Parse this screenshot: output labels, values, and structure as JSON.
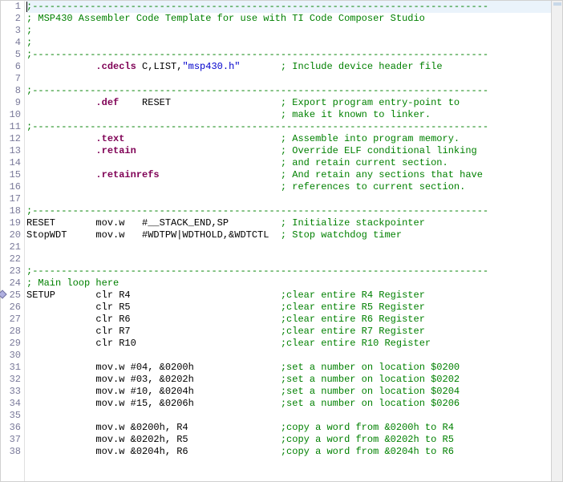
{
  "editor": {
    "cursor_line": 1,
    "marker_line": 25,
    "lines": [
      {
        "n": 1,
        "segments": [
          {
            "cls": "c-comment",
            "t": ";-------------------------------------------------------------------------------"
          }
        ]
      },
      {
        "n": 2,
        "segments": [
          {
            "cls": "c-comment",
            "t": "; MSP430 Assembler Code Template for use with TI Code Composer Studio"
          }
        ]
      },
      {
        "n": 3,
        "segments": [
          {
            "cls": "c-comment",
            "t": ";"
          }
        ]
      },
      {
        "n": 4,
        "segments": [
          {
            "cls": "c-comment",
            "t": ";"
          }
        ]
      },
      {
        "n": 5,
        "segments": [
          {
            "cls": "c-comment",
            "t": ";-------------------------------------------------------------------------------"
          }
        ]
      },
      {
        "n": 6,
        "segments": [
          {
            "cls": "c-plain",
            "t": "            "
          },
          {
            "cls": "c-directive",
            "t": ".cdecls"
          },
          {
            "cls": "c-plain",
            "t": " C,LIST,"
          },
          {
            "cls": "c-string",
            "t": "\"msp430.h\""
          },
          {
            "cls": "c-plain",
            "t": "       "
          },
          {
            "cls": "c-comment",
            "t": "; Include device header file"
          }
        ]
      },
      {
        "n": 7,
        "segments": [
          {
            "cls": "c-plain",
            "t": ""
          }
        ]
      },
      {
        "n": 8,
        "segments": [
          {
            "cls": "c-comment",
            "t": ";-------------------------------------------------------------------------------"
          }
        ]
      },
      {
        "n": 9,
        "segments": [
          {
            "cls": "c-plain",
            "t": "            "
          },
          {
            "cls": "c-directive",
            "t": ".def"
          },
          {
            "cls": "c-plain",
            "t": "    RESET                   "
          },
          {
            "cls": "c-comment",
            "t": "; Export program entry-point to"
          }
        ]
      },
      {
        "n": 10,
        "segments": [
          {
            "cls": "c-plain",
            "t": "                                            "
          },
          {
            "cls": "c-comment",
            "t": "; make it known to linker."
          }
        ]
      },
      {
        "n": 11,
        "segments": [
          {
            "cls": "c-comment",
            "t": ";-------------------------------------------------------------------------------"
          }
        ]
      },
      {
        "n": 12,
        "segments": [
          {
            "cls": "c-plain",
            "t": "            "
          },
          {
            "cls": "c-directive",
            "t": ".text"
          },
          {
            "cls": "c-plain",
            "t": "                           "
          },
          {
            "cls": "c-comment",
            "t": "; Assemble into program memory."
          }
        ]
      },
      {
        "n": 13,
        "segments": [
          {
            "cls": "c-plain",
            "t": "            "
          },
          {
            "cls": "c-directive",
            "t": ".retain"
          },
          {
            "cls": "c-plain",
            "t": "                         "
          },
          {
            "cls": "c-comment",
            "t": "; Override ELF conditional linking"
          }
        ]
      },
      {
        "n": 14,
        "segments": [
          {
            "cls": "c-plain",
            "t": "                                            "
          },
          {
            "cls": "c-comment",
            "t": "; and retain current section."
          }
        ]
      },
      {
        "n": 15,
        "segments": [
          {
            "cls": "c-plain",
            "t": "            "
          },
          {
            "cls": "c-directive",
            "t": ".retainrefs"
          },
          {
            "cls": "c-plain",
            "t": "                     "
          },
          {
            "cls": "c-comment",
            "t": "; And retain any sections that have"
          }
        ]
      },
      {
        "n": 16,
        "segments": [
          {
            "cls": "c-plain",
            "t": "                                            "
          },
          {
            "cls": "c-comment",
            "t": "; references to current section."
          }
        ]
      },
      {
        "n": 17,
        "segments": [
          {
            "cls": "c-plain",
            "t": ""
          }
        ]
      },
      {
        "n": 18,
        "segments": [
          {
            "cls": "c-comment",
            "t": ";-------------------------------------------------------------------------------"
          }
        ]
      },
      {
        "n": 19,
        "segments": [
          {
            "cls": "c-plain",
            "t": "RESET       mov.w   #__STACK_END,SP         "
          },
          {
            "cls": "c-comment",
            "t": "; Initialize stackpointer"
          }
        ]
      },
      {
        "n": 20,
        "segments": [
          {
            "cls": "c-plain",
            "t": "StopWDT     mov.w   #WDTPW|WDTHOLD,&WDTCTL  "
          },
          {
            "cls": "c-comment",
            "t": "; Stop watchdog timer"
          }
        ]
      },
      {
        "n": 21,
        "segments": [
          {
            "cls": "c-plain",
            "t": ""
          }
        ]
      },
      {
        "n": 22,
        "segments": [
          {
            "cls": "c-plain",
            "t": ""
          }
        ]
      },
      {
        "n": 23,
        "segments": [
          {
            "cls": "c-comment",
            "t": ";-------------------------------------------------------------------------------"
          }
        ]
      },
      {
        "n": 24,
        "segments": [
          {
            "cls": "c-comment",
            "t": "; Main loop here"
          }
        ]
      },
      {
        "n": 25,
        "segments": [
          {
            "cls": "c-plain",
            "t": "SETUP       clr R4                          "
          },
          {
            "cls": "c-comment",
            "t": ";clear entire R4 Register"
          }
        ]
      },
      {
        "n": 26,
        "segments": [
          {
            "cls": "c-plain",
            "t": "            clr R5                          "
          },
          {
            "cls": "c-comment",
            "t": ";clear entire R5 Register"
          }
        ]
      },
      {
        "n": 27,
        "segments": [
          {
            "cls": "c-plain",
            "t": "            clr R6                          "
          },
          {
            "cls": "c-comment",
            "t": ";clear entire R6 Register"
          }
        ]
      },
      {
        "n": 28,
        "segments": [
          {
            "cls": "c-plain",
            "t": "            clr R7                          "
          },
          {
            "cls": "c-comment",
            "t": ";clear entire R7 Register"
          }
        ]
      },
      {
        "n": 29,
        "segments": [
          {
            "cls": "c-plain",
            "t": "            clr R10                         "
          },
          {
            "cls": "c-comment",
            "t": ";clear entire R10 Register"
          }
        ]
      },
      {
        "n": 30,
        "segments": [
          {
            "cls": "c-plain",
            "t": ""
          }
        ]
      },
      {
        "n": 31,
        "segments": [
          {
            "cls": "c-plain",
            "t": "            mov.w #04, &0200h               "
          },
          {
            "cls": "c-comment",
            "t": ";set a number on location $0200"
          }
        ]
      },
      {
        "n": 32,
        "segments": [
          {
            "cls": "c-plain",
            "t": "            mov.w #03, &0202h               "
          },
          {
            "cls": "c-comment",
            "t": ";set a number on location $0202"
          }
        ]
      },
      {
        "n": 33,
        "segments": [
          {
            "cls": "c-plain",
            "t": "            mov.w #10, &0204h               "
          },
          {
            "cls": "c-comment",
            "t": ";set a number on location $0204"
          }
        ]
      },
      {
        "n": 34,
        "segments": [
          {
            "cls": "c-plain",
            "t": "            mov.w #15, &0206h               "
          },
          {
            "cls": "c-comment",
            "t": ";set a number on location $0206"
          }
        ]
      },
      {
        "n": 35,
        "segments": [
          {
            "cls": "c-plain",
            "t": ""
          }
        ]
      },
      {
        "n": 36,
        "segments": [
          {
            "cls": "c-plain",
            "t": "            mov.w &0200h, R4                "
          },
          {
            "cls": "c-comment",
            "t": ";copy a word from &0200h to R4"
          }
        ]
      },
      {
        "n": 37,
        "segments": [
          {
            "cls": "c-plain",
            "t": "            mov.w &0202h, R5                "
          },
          {
            "cls": "c-comment",
            "t": ";copy a word from &0202h to R5"
          }
        ]
      },
      {
        "n": 38,
        "segments": [
          {
            "cls": "c-plain",
            "t": "            mov.w &0204h, R6                "
          },
          {
            "cls": "c-comment",
            "t": ";copy a word from &0204h to R6"
          }
        ]
      }
    ]
  }
}
